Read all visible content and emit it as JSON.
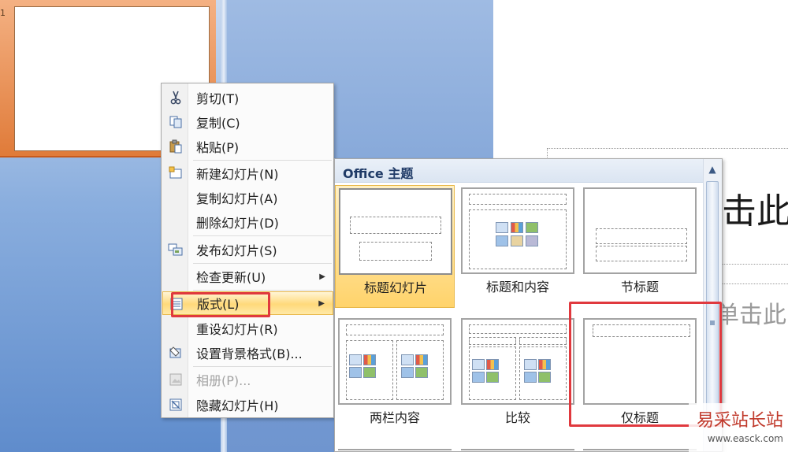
{
  "thumbnail": {
    "number": "1"
  },
  "slide": {
    "title_text": "击此",
    "subtitle_text": "单击此"
  },
  "context_menu": {
    "items": [
      {
        "label": "剪切(T)",
        "icon": "scissors-icon"
      },
      {
        "label": "复制(C)",
        "icon": "copy-icon"
      },
      {
        "label": "粘贴(P)",
        "icon": "paste-icon"
      },
      {
        "label": "新建幻灯片(N)",
        "icon": "new-slide-icon"
      },
      {
        "label": "复制幻灯片(A)"
      },
      {
        "label": "删除幻灯片(D)"
      },
      {
        "label": "发布幻灯片(S)",
        "icon": "publish-slides-icon"
      },
      {
        "label": "检查更新(U)",
        "has_submenu": true
      },
      {
        "label": "版式(L)",
        "icon": "layout-icon",
        "has_submenu": true,
        "highlighted": true
      },
      {
        "label": "重设幻灯片(R)"
      },
      {
        "label": "设置背景格式(B)...",
        "icon": "format-background-icon"
      },
      {
        "label": "相册(P)...",
        "icon": "photo-album-icon",
        "disabled": true
      },
      {
        "label": "隐藏幻灯片(H)",
        "icon": "hide-slide-icon"
      }
    ]
  },
  "layout_gallery": {
    "header": "Office 主题",
    "layouts": [
      {
        "label": "标题幻灯片",
        "selected": true
      },
      {
        "label": "标题和内容"
      },
      {
        "label": "节标题"
      },
      {
        "label": "两栏内容"
      },
      {
        "label": "比较"
      },
      {
        "label": "仅标题"
      }
    ]
  },
  "watermark": {
    "main": "易采站长站",
    "sub": "www.easck.com"
  },
  "colors": {
    "highlight_border": "#e0393e",
    "menu_hover": "#ffd97a",
    "header_text": "#1f3a66"
  }
}
